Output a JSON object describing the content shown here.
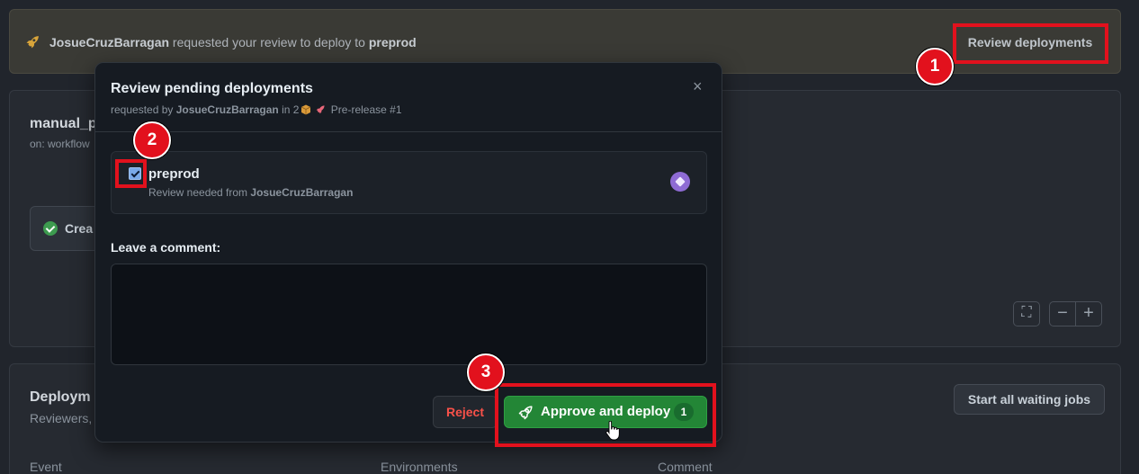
{
  "banner": {
    "actor": "JosueCruzBarragan",
    "middle_text": " requested your review to deploy to ",
    "environment": "preprod",
    "review_button": "Review deployments"
  },
  "workflow": {
    "name": "manual_p",
    "trigger": "on: workflow",
    "job_label": "Crea"
  },
  "deployments": {
    "title": "Deploym",
    "subtitle": "Reviewers,",
    "start_button": "Start all waiting jobs",
    "columns": [
      "Event",
      "Environments",
      "Comment"
    ]
  },
  "zoom_controls": [
    "⛶",
    "−",
    "+"
  ],
  "modal": {
    "title": "Review pending deployments",
    "requested_by_prefix": "requested by ",
    "requester": "JosueCruzBarragan",
    "requested_in": " in 2",
    "release": "Pre-release #1",
    "close_label": "×",
    "environment": {
      "name": "preprod",
      "checked": true,
      "review_prefix": "Review needed from ",
      "reviewer": "JosueCruzBarragan"
    },
    "comment_label": "Leave a comment:",
    "comment_value": "",
    "reject_button": "Reject",
    "approve_button": "Approve and deploy",
    "approve_count": "1"
  },
  "annotations": {
    "step1": "1",
    "step2": "2",
    "step3": "3",
    "highlight_color": "#e2111d"
  },
  "colors": {
    "approve_green": "#238636",
    "reject_red": "#f85149",
    "banner_bg": "#3a3a35"
  },
  "icons": [
    "rocket-icon",
    "close-icon",
    "checkbox-icon",
    "avatar-icon",
    "check-circle-icon",
    "fullscreen-icon",
    "package-icon",
    "pointer-cursor-icon"
  ]
}
